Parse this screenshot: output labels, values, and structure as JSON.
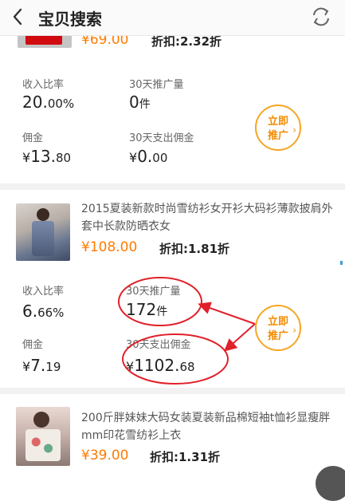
{
  "header": {
    "title": "宝贝搜索",
    "back_icon": "chevron-left-icon",
    "refresh_icon": "refresh-icon"
  },
  "items": [
    {
      "price": "¥69.00",
      "discount": "折扣:2.32折",
      "stats": {
        "rate_label": "收入比率",
        "rate_value": "20.",
        "rate_dec": "00%",
        "promo_label": "30天推广量",
        "promo_value": "0",
        "promo_unit": "件",
        "commission_label": "佣金",
        "commission_cur": "¥",
        "commission_value": "13.",
        "commission_dec": "80",
        "spend_label": "30天支出佣金",
        "spend_cur": "¥",
        "spend_value": "0.",
        "spend_dec": "00"
      },
      "button": {
        "line1": "立即",
        "line2": "推广",
        "chevron": "›"
      }
    },
    {
      "title": "2015夏装新款时尚雪纺衫女开衫大码衫薄款披肩外套中长款防晒衣女",
      "price": "¥108.00",
      "discount": "折扣:1.81折",
      "stats": {
        "rate_label": "收入比率",
        "rate_value": "6.",
        "rate_dec": "66%",
        "promo_label": "30天推广量",
        "promo_value": "172",
        "promo_unit": "件",
        "commission_label": "佣金",
        "commission_cur": "¥",
        "commission_value": "7.",
        "commission_dec": "19",
        "spend_label": "30天支出佣金",
        "spend_cur": "¥",
        "spend_value": "1102.",
        "spend_dec": "68"
      },
      "button": {
        "line1": "立即",
        "line2": "推广",
        "chevron": "›"
      }
    },
    {
      "title": "200斤胖妹妹大码女装夏装新品棉短袖t恤衫显瘦胖mm印花雪纺衫上衣",
      "price": "¥39.00",
      "discount": "折扣:1.31折"
    }
  ],
  "colors": {
    "accent": "#ff7a00",
    "promo_ring": "#f5a623",
    "annotation": "#e0202a"
  }
}
